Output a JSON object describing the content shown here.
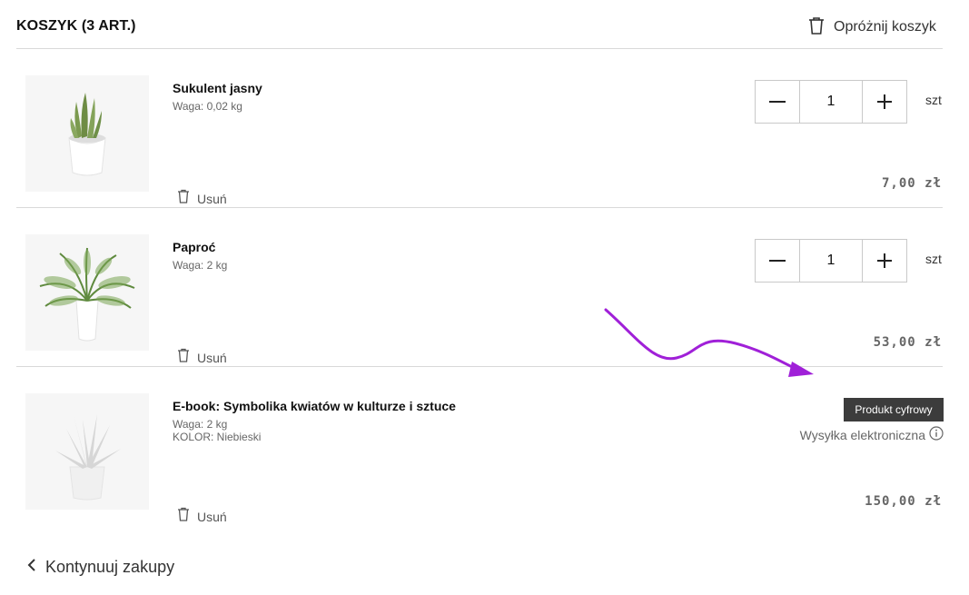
{
  "header": {
    "title": "KOSZYK (3 ART.)",
    "empty_cart_label": "Opróżnij koszyk",
    "empty_cart_icon": "trash-icon"
  },
  "items": [
    {
      "name": "Sukulent jasny",
      "weight": "Waga: 0,02 kg",
      "quantity": "1",
      "unit": "szt",
      "price": "7,00 zł",
      "remove_label": "Usuń",
      "image": "succulent-plant-image"
    },
    {
      "name": "Paproć",
      "weight": "Waga: 2 kg",
      "quantity": "1",
      "unit": "szt",
      "price": "53,00 zł",
      "remove_label": "Usuń",
      "image": "fern-plant-image"
    },
    {
      "name": "E-book: Symbolika kwiatów w kulturze i sztuce",
      "weight": "Waga: 2 kg",
      "option": "KOLOR: Niebieski",
      "badge": "Produkt cyfrowy",
      "shipping": "Wysyłka elektroniczna",
      "price": "150,00 zł",
      "remove_label": "Usuń",
      "image": "aloe-plant-image-faded"
    }
  ],
  "footer": {
    "continue_label": "Kontynuuj zakupy"
  },
  "colors": {
    "annotation_arrow": "#a020d8",
    "badge_bg": "#3c3c3c",
    "divider": "#d9d9d9"
  }
}
